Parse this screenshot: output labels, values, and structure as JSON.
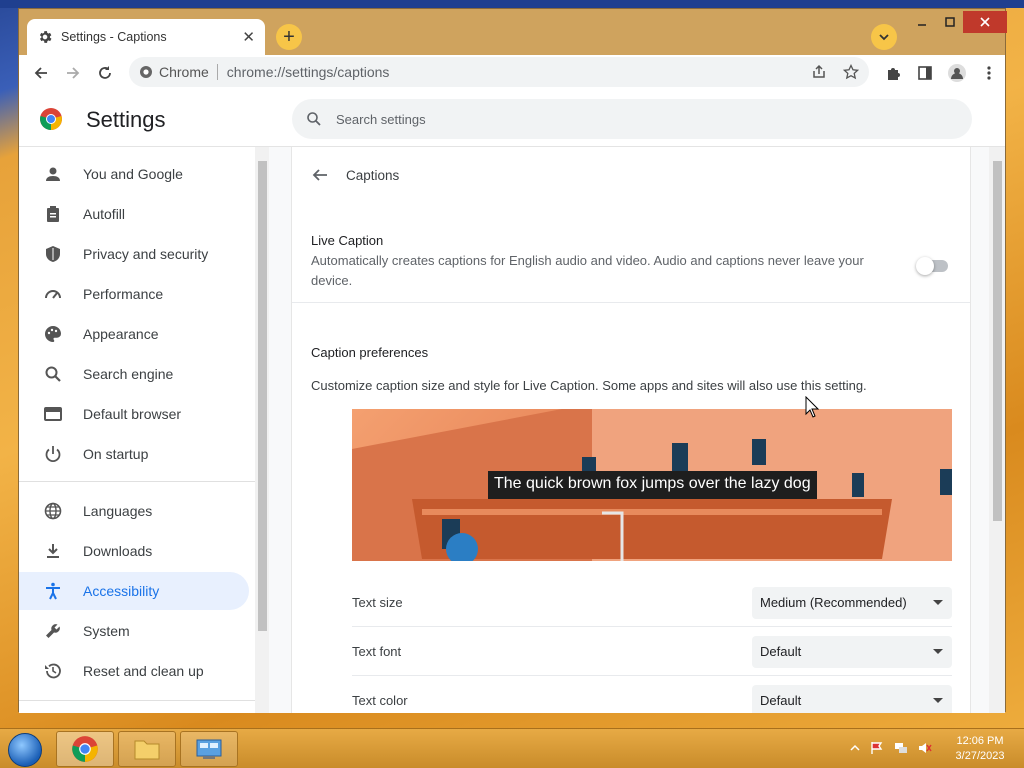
{
  "browser": {
    "tab_title": "Settings - Captions",
    "tab_close": "✕",
    "new_tab": "+",
    "omnibox_site": "Chrome",
    "omnibox_url": "chrome://settings/captions"
  },
  "settings": {
    "title": "Settings",
    "search_placeholder": "Search settings"
  },
  "sidebar": {
    "items": [
      {
        "label": "You and Google",
        "icon": "person-icon"
      },
      {
        "label": "Autofill",
        "icon": "clipboard-icon"
      },
      {
        "label": "Privacy and security",
        "icon": "shield-icon"
      },
      {
        "label": "Performance",
        "icon": "speedometer-icon"
      },
      {
        "label": "Appearance",
        "icon": "palette-icon"
      },
      {
        "label": "Search engine",
        "icon": "search-icon"
      },
      {
        "label": "Default browser",
        "icon": "browser-icon"
      },
      {
        "label": "On startup",
        "icon": "power-icon"
      },
      {
        "label": "Languages",
        "icon": "globe-icon"
      },
      {
        "label": "Downloads",
        "icon": "download-icon"
      },
      {
        "label": "Accessibility",
        "icon": "accessibility-icon",
        "active": true
      },
      {
        "label": "System",
        "icon": "wrench-icon"
      },
      {
        "label": "Reset and clean up",
        "icon": "history-icon"
      }
    ]
  },
  "captions": {
    "page_title": "Captions",
    "live_caption_title": "Live Caption",
    "live_caption_desc": "Automatically creates captions for English audio and video. Audio and captions never leave your device.",
    "live_caption_enabled": false,
    "prefs_title": "Caption preferences",
    "prefs_desc": "Customize caption size and style for Live Caption. Some apps and sites will also use this setting.",
    "preview_caption": "The quick brown fox jumps over the lazy dog",
    "rows": [
      {
        "label": "Text size",
        "value": "Medium (Recommended)"
      },
      {
        "label": "Text font",
        "value": "Default"
      },
      {
        "label": "Text color",
        "value": "Default"
      }
    ]
  },
  "taskbar": {
    "time": "12:06 PM",
    "date": "3/27/2023"
  },
  "colors": {
    "accent": "#1a73e8",
    "active_nav_bg": "#e8f0fe",
    "titlebar": "#cfa35e"
  }
}
